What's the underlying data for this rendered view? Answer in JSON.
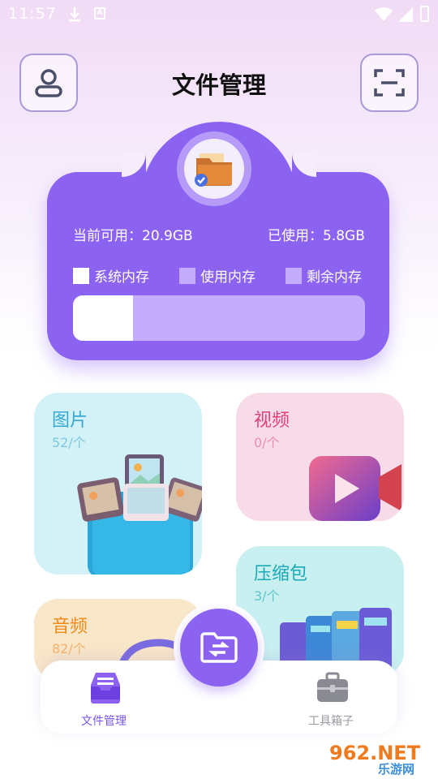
{
  "status_bar": {
    "time": "11:57"
  },
  "header": {
    "title": "文件管理"
  },
  "storage": {
    "available_label": "当前可用：20.9GB",
    "used_label": "已使用：5.8GB",
    "used_fraction": 0.205,
    "legend": [
      {
        "label": "系统内存",
        "color": "#ffffff"
      },
      {
        "label": "使用内存",
        "color": "#c2acfb"
      },
      {
        "label": "剩余内存",
        "color": "#c2acfb"
      }
    ]
  },
  "categories": {
    "images": {
      "name": "图片",
      "count": "52/个"
    },
    "video": {
      "name": "视频",
      "count": "0/个"
    },
    "archive": {
      "name": "压缩包",
      "count": "3/个"
    },
    "audio": {
      "name": "音频",
      "count": "82/个"
    }
  },
  "bottom_nav": {
    "file_manager": "文件管理",
    "toolbox": "工具箱子"
  },
  "watermark": {
    "top": "962.NET",
    "bottom": "乐游网"
  },
  "colors": {
    "accent": "#8c63f1",
    "images_tile": "#d3f2f8",
    "video_tile": "#f7dbe8",
    "archive_tile": "#c9f0f1",
    "audio_tile": "#f9e7c9"
  }
}
